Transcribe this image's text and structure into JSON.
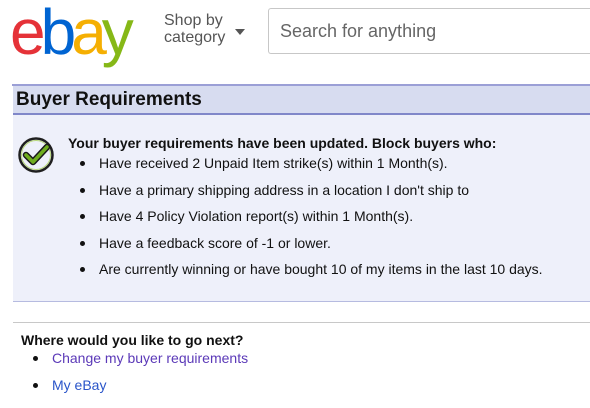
{
  "header": {
    "logo": {
      "e": "e",
      "b": "b",
      "a": "a",
      "y": "y"
    },
    "shop_by_line1": "Shop by",
    "shop_by_line2": "category",
    "search_placeholder": "Search for anything"
  },
  "page": {
    "title": "Buyer Requirements",
    "updated_message": "Your buyer requirements have been updated. Block buyers who:",
    "requirements": [
      "Have received 2 Unpaid Item strike(s) within 1 Month(s).",
      "Have a primary shipping address in a location I don't ship to",
      "Have 4 Policy Violation report(s) within 1 Month(s).",
      "Have a feedback score of -1 or lower.",
      "Are currently winning or have bought 10 of my items in the last 10 days."
    ]
  },
  "next": {
    "title": "Where would you like to go next?",
    "links": [
      "Change my buyer requirements",
      "My eBay"
    ]
  },
  "colors": {
    "logo_e": "#e53238",
    "logo_b": "#0064d2",
    "logo_a": "#f5af02",
    "logo_y": "#86b817",
    "title_bar_bg": "#d7dcf0",
    "panel_bg": "#eef0fa",
    "success_check": "#6fae1e",
    "link_visited": "#5b39b8",
    "link": "#2a55c9"
  },
  "icons": {
    "success": "checkmark-circle-icon",
    "dropdown": "caret-down-icon"
  }
}
